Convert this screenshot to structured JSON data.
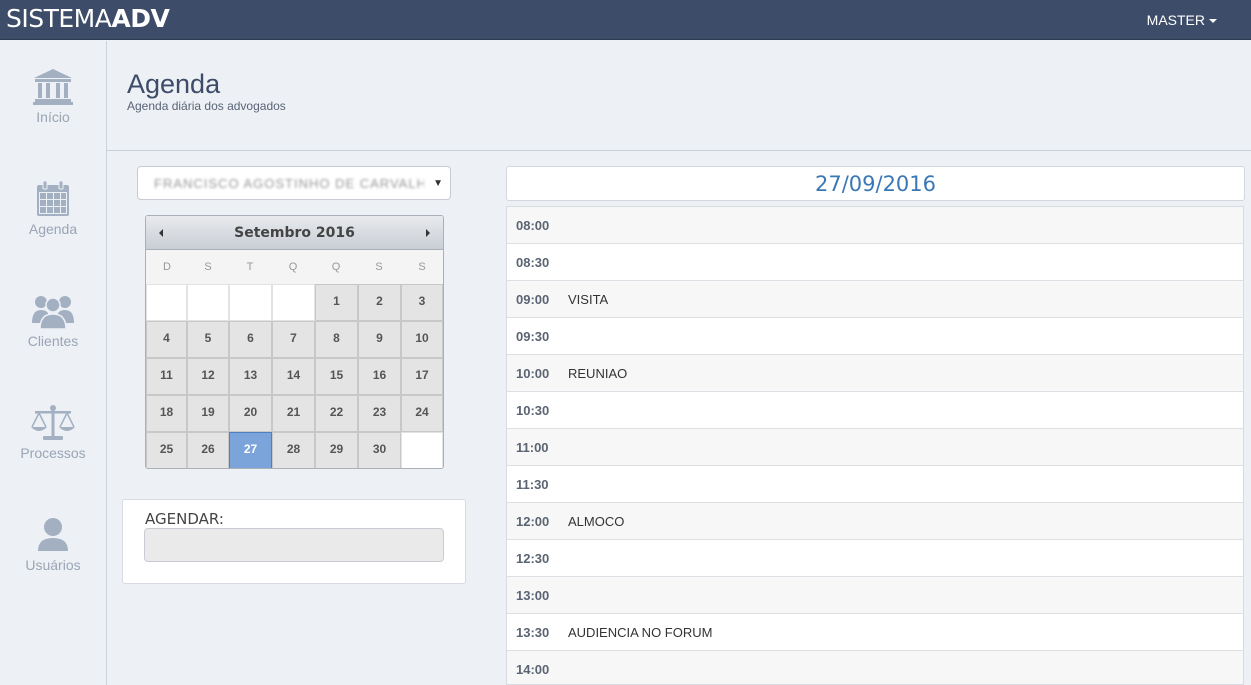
{
  "brand": {
    "light": "SISTEMA",
    "bold": "ADV"
  },
  "user_menu": {
    "label": "MASTER"
  },
  "sidebar": {
    "items": [
      {
        "label": "Início",
        "icon": "bank-icon"
      },
      {
        "label": "Agenda",
        "icon": "calendar-icon"
      },
      {
        "label": "Clientes",
        "icon": "users-icon"
      },
      {
        "label": "Processos",
        "icon": "scales-icon"
      },
      {
        "label": "Usuários",
        "icon": "user-icon"
      }
    ]
  },
  "page": {
    "title": "Agenda",
    "subtitle": "Agenda diária dos advogados"
  },
  "lawyer_select": {
    "value": "FRANCISCO AGOSTINHO DE CARVALHO"
  },
  "calendar": {
    "title": "Setembro 2016",
    "weekdays": [
      "D",
      "S",
      "T",
      "Q",
      "Q",
      "S",
      "S"
    ],
    "selected_day": "27",
    "weeks": [
      [
        "",
        "",
        "",
        "",
        "1",
        "2",
        "3"
      ],
      [
        "4",
        "5",
        "6",
        "7",
        "8",
        "9",
        "10"
      ],
      [
        "11",
        "12",
        "13",
        "14",
        "15",
        "16",
        "17"
      ],
      [
        "18",
        "19",
        "20",
        "21",
        "22",
        "23",
        "24"
      ],
      [
        "25",
        "26",
        "27",
        "28",
        "29",
        "30",
        ""
      ]
    ]
  },
  "agendar": {
    "label": "AGENDAR:",
    "value": ""
  },
  "schedule": {
    "date": "27/09/2016",
    "slots": [
      {
        "time": "08:00",
        "event": ""
      },
      {
        "time": "08:30",
        "event": ""
      },
      {
        "time": "09:00",
        "event": "VISITA"
      },
      {
        "time": "09:30",
        "event": ""
      },
      {
        "time": "10:00",
        "event": "REUNIAO"
      },
      {
        "time": "10:30",
        "event": ""
      },
      {
        "time": "11:00",
        "event": ""
      },
      {
        "time": "11:30",
        "event": ""
      },
      {
        "time": "12:00",
        "event": "ALMOCO"
      },
      {
        "time": "12:30",
        "event": ""
      },
      {
        "time": "13:00",
        "event": ""
      },
      {
        "time": "13:30",
        "event": "AUDIENCIA NO FORUM"
      },
      {
        "time": "14:00",
        "event": ""
      }
    ]
  },
  "colors": {
    "topbar": "#3d4c68",
    "accent": "#3a78b5",
    "selected_day": "#7ba4da",
    "sidebar_icon": "#a3b0c2"
  }
}
